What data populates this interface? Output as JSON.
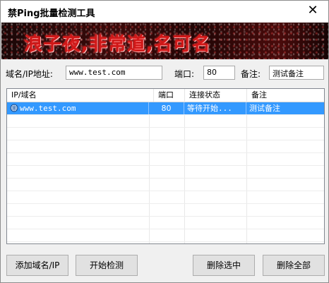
{
  "window": {
    "title": "禁Ping批量检测工具"
  },
  "banner": {
    "text": "浪子夜,非常道,名可名"
  },
  "form": {
    "domain_label": "域名/IP地址:",
    "domain_value": "www.test.com",
    "port_label": "端口:",
    "port_value": "80",
    "note_label": "备注:",
    "note_value": "测试备注"
  },
  "table": {
    "columns": [
      "IP/域名",
      "端口",
      "连接状态",
      "备注"
    ],
    "rows": [
      {
        "host": "www.test.com",
        "port": "80",
        "status": "等待开始...",
        "note": "测试备注",
        "selected": true
      }
    ]
  },
  "buttons": {
    "add": "添加域名/IP",
    "start": "开始检测",
    "delete_selected": "删除选中",
    "delete_all": "删除全部"
  },
  "colors": {
    "selection": "#3399ff",
    "banner_text": "#d01818"
  },
  "icons": {
    "close": "close-icon",
    "row": "globe-icon"
  }
}
